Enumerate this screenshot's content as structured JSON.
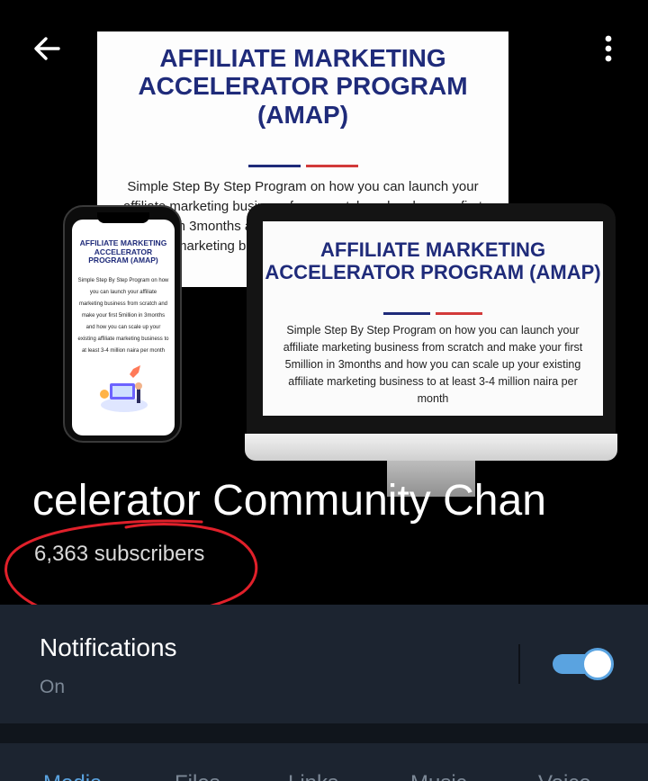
{
  "header": {
    "back_icon": "arrow-left-icon",
    "more_icon": "more-vertical-icon",
    "channel_title": "celerator Community Chan",
    "subscribers": "6,363 subscribers",
    "annotation_color": "#e0202a"
  },
  "promo": {
    "title": "AFFILIATE MARKETING ACCELERATOR PROGRAM (AMAP)",
    "description": "Simple Step By Step Program on how you can launch your affiliate marketing business from scratch and make your first 5million in 3months and how you can scale up your existing affiliate marketing business to at least 3-4 million naira per month",
    "back_sheet_description": "Simple Step By Step Program on how you can launch your affiliate marketing business from scratch and make your first 5million in 3months and how you can scale up your existing affiliate marketing business to at least 3-4 million naira per month"
  },
  "notifications": {
    "label": "Notifications",
    "status": "On",
    "enabled": true,
    "accent": "#5aa3e0"
  },
  "tabs": [
    {
      "label": "Media",
      "active": true
    },
    {
      "label": "Files",
      "active": false
    },
    {
      "label": "Links",
      "active": false
    },
    {
      "label": "Music",
      "active": false
    },
    {
      "label": "Voice",
      "active": false
    }
  ],
  "colors": {
    "background": "#000000",
    "panel": "#1c2430",
    "accent": "#5aa3e0"
  }
}
